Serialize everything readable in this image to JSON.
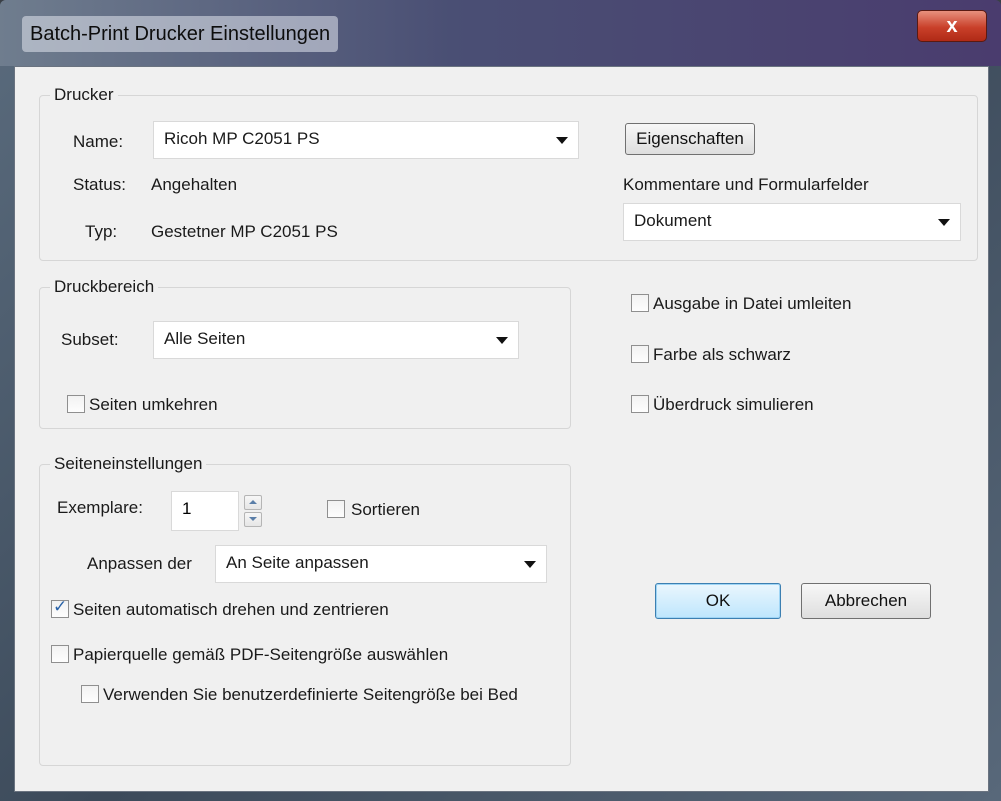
{
  "window": {
    "title": "Batch-Print Drucker Einstellungen",
    "close_label": "x"
  },
  "drucker": {
    "group_title": "Drucker",
    "name_label": "Name:",
    "name_value": "Ricoh MP C2051 PS",
    "status_label": "Status:",
    "status_value": "Angehalten",
    "typ_label": "Typ:",
    "typ_value": "Gestetner MP C2051 PS",
    "properties_button": "Eigenschaften",
    "comments_label": "Kommentare und Formularfelder",
    "comments_value": "Dokument"
  },
  "druckbereich": {
    "group_title": "Druckbereich",
    "subset_label": "Subset:",
    "subset_value": "Alle Seiten",
    "reverse_label": "Seiten umkehren",
    "reverse_checked": false
  },
  "options": {
    "redirect_label": "Ausgabe in Datei umleiten",
    "redirect_checked": false,
    "black_label": "Farbe als schwarz",
    "black_checked": false,
    "overprint_label": "Überdruck simulieren",
    "overprint_checked": false
  },
  "seiteneinstellungen": {
    "group_title": "Seiteneinstellungen",
    "copies_label": "Exemplare:",
    "copies_value": "1",
    "sort_label": "Sortieren",
    "sort_checked": false,
    "fit_label": "Anpassen der",
    "fit_value": "An Seite anpassen",
    "autorotate_label": "Seiten automatisch drehen und zentrieren",
    "autorotate_checked": true,
    "papersource_label": "Papierquelle gemäß PDF-Seitengröße auswählen",
    "papersource_checked": false,
    "custompage_label": "Verwenden Sie benutzerdefinierte Seitengröße bei Bed",
    "custompage_checked": false
  },
  "actions": {
    "ok_label": "OK",
    "cancel_label": "Abbrechen"
  },
  "icons": {
    "check": "check-icon",
    "dropdown": "chevron-down-icon",
    "spin_up": "spin-up-icon",
    "spin_down": "spin-down-icon",
    "close": "close-icon"
  }
}
